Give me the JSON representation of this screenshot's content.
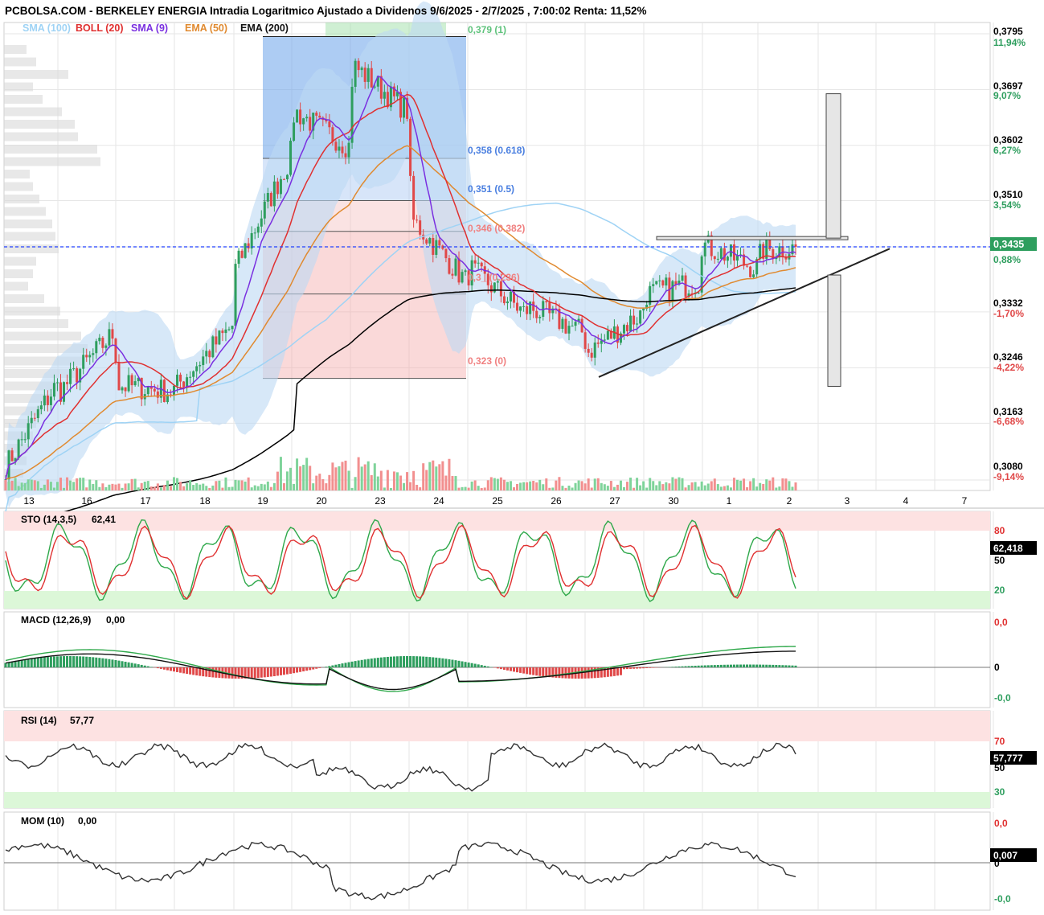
{
  "title": "PCBOLSA.COM - BERKELEY ENERGIA Intradia Logaritmico Ajustado a Dividenos 9/6/2025 - 2/7/2025 , 7:00:02 Renta: 11,52%",
  "colors": {
    "sma100": "#9fd3f5",
    "boll": "#e03030",
    "sma9": "#7a2fe0",
    "ema50": "#e08a30",
    "ema200": "#000000",
    "up": "#2e9e5e",
    "down": "#e04848",
    "fibBlue": "#4a7fe0",
    "fibRed": "#f08080",
    "overbought": "#fde2e2",
    "oversold": "#dcf7d8",
    "grid": "#e6e6e6"
  },
  "legend": [
    {
      "label": "SMA (100)",
      "color": "#9fd3f5"
    },
    {
      "label": "BOLL (20)",
      "color": "#e03030"
    },
    {
      "label": "SMA (9)",
      "color": "#7a2fe0"
    },
    {
      "label": "EMA (50)",
      "color": "#e08a30"
    },
    {
      "label": "EMA (200)",
      "color": "#000000"
    }
  ],
  "x_labels": [
    "13",
    "16",
    "17",
    "18",
    "19",
    "20",
    "23",
    "24",
    "25",
    "26",
    "27",
    "30",
    "1",
    "2",
    "3",
    "4",
    "7"
  ],
  "price_axis": [
    {
      "price": "0,3795",
      "pct": "11,94%",
      "color": "#2e9e5e"
    },
    {
      "price": "0,3697",
      "pct": "9,07%",
      "color": "#2e9e5e"
    },
    {
      "price": "0,3602",
      "pct": "6,27%",
      "color": "#2e9e5e"
    },
    {
      "price": "0,3510",
      "pct": "3,54%",
      "color": "#2e9e5e"
    },
    {
      "price": "",
      "pct": "0,88%",
      "color": "#2e9e5e"
    },
    {
      "price": "0,3332",
      "pct": "-1,70%",
      "color": "#e04848"
    },
    {
      "price": "0,3246",
      "pct": "-4,22%",
      "color": "#e04848"
    },
    {
      "price": "0,3163",
      "pct": "-6,68%",
      "color": "#e04848"
    },
    {
      "price": "0,3080",
      "pct": "-9,14%",
      "color": "#e04848"
    }
  ],
  "last_price": "0,3435",
  "fib_labels": [
    "0,379 (1)",
    "0,358 (0.618)",
    "0,351 (0.5)",
    "0,346 (0.382)",
    "0,3_ (0.236)",
    "0,323 (0)"
  ],
  "panels": {
    "sto": {
      "title": "STO (14,3,5)",
      "value": "62,41",
      "last": "62,418",
      "levels": [
        "80",
        "50",
        "20"
      ]
    },
    "macd": {
      "title": "MACD (12,26,9)",
      "value": "0,00",
      "levels": [
        "0,0",
        "0",
        "-0,0"
      ]
    },
    "rsi": {
      "title": "RSI (14)",
      "value": "57,77",
      "last": "57,777",
      "levels": [
        "70",
        "50",
        "30"
      ]
    },
    "mom": {
      "title": "MOM (10)",
      "value": "0,00",
      "last": "0,007",
      "levels": [
        "0,0",
        "0",
        "-0,0"
      ]
    }
  },
  "chart_data": [
    {
      "type": "candlestick",
      "title": "PCBOLSA.COM - BERKELEY ENERGIA Intradia Logaritmico Ajustado a Dividenos 9/6/2025 - 2/7/2025 , 7:00:02 Renta: 11,52%",
      "scale": "log",
      "ylim": [
        0.3065,
        0.3815
      ],
      "x_categories": [
        "13",
        "16",
        "17",
        "18",
        "19",
        "20",
        "23",
        "24",
        "25",
        "26",
        "27",
        "30",
        "1",
        "2",
        "3",
        "4",
        "7"
      ],
      "close_path": [
        [
          13,
          0.309
        ],
        [
          13,
          0.322
        ],
        [
          16,
          0.321
        ],
        [
          16,
          0.33
        ],
        [
          17,
          0.322
        ],
        [
          17,
          0.321
        ],
        [
          18,
          0.322
        ],
        [
          18,
          0.331
        ],
        [
          19,
          0.34
        ],
        [
          19,
          0.358
        ],
        [
          20,
          0.366
        ],
        [
          20,
          0.36
        ],
        [
          23,
          0.374
        ],
        [
          23,
          0.366
        ],
        [
          24,
          0.348
        ],
        [
          24,
          0.338
        ],
        [
          25,
          0.34
        ],
        [
          25,
          0.333
        ],
        [
          26,
          0.334
        ],
        [
          26,
          0.33
        ],
        [
          27,
          0.327
        ],
        [
          27,
          0.333
        ],
        [
          30,
          0.336
        ],
        [
          30,
          0.338
        ],
        [
          1,
          0.344
        ],
        [
          1,
          0.34
        ],
        [
          2,
          0.343
        ],
        [
          2,
          0.3435
        ]
      ],
      "last": 0.3435,
      "fibonacci": [
        {
          "level": 1,
          "price": 0.379
        },
        {
          "level": 0.618,
          "price": 0.358
        },
        {
          "level": 0.5,
          "price": 0.351
        },
        {
          "level": 0.382,
          "price": 0.346
        },
        {
          "level": 0.236,
          "price": 0.336
        },
        {
          "level": 0,
          "price": 0.323
        }
      ],
      "trendline_from": [
        27,
        0.3232
      ],
      "trendline_to": [
        4,
        0.3432
      ],
      "resistance": 0.3449
    },
    {
      "type": "line",
      "title": "STO (14,3,5)",
      "last": 62.418,
      "ylim": [
        0,
        100
      ],
      "levels": [
        80,
        50,
        20
      ]
    },
    {
      "type": "line",
      "title": "MACD (12,26,9)",
      "last": 0.0
    },
    {
      "type": "line",
      "title": "RSI (14)",
      "last": 57.777,
      "ylim": [
        0,
        100
      ],
      "levels": [
        70,
        50,
        30
      ]
    },
    {
      "type": "line",
      "title": "MOM (10)",
      "last": 0.007
    }
  ]
}
